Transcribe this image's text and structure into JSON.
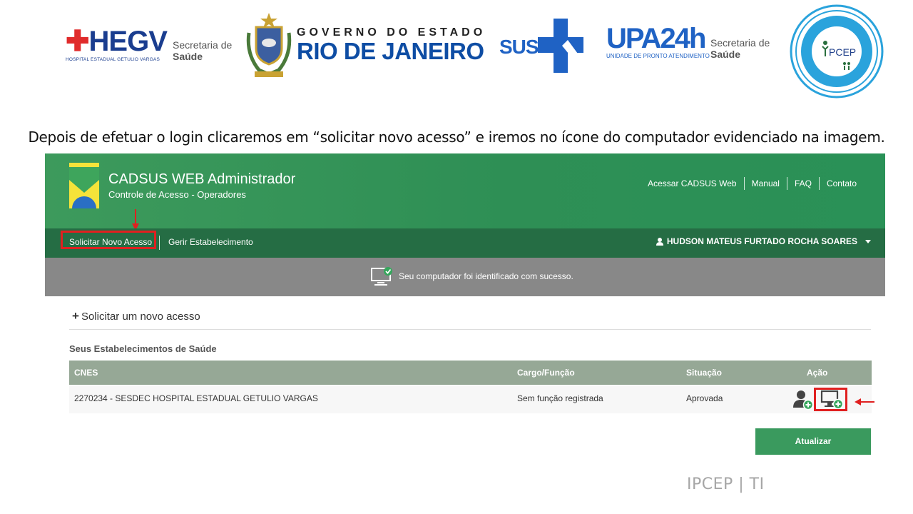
{
  "logos": {
    "hegv": {
      "mark": "HEGV",
      "sub": "HOSPITAL ESTADUAL GETULIO VARGAS"
    },
    "secretaria_1": {
      "line1": "Secretaria de",
      "line2": "Saúde"
    },
    "governo": {
      "line1": "GOVERNO DO ESTADO",
      "line2": "RIO DE JANEIRO"
    },
    "sus": {
      "text": "SUS"
    },
    "upa": {
      "mark_a": "UPA",
      "mark_b": "24h",
      "sub": "UNIDADE DE PRONTO ATENDIMENTO"
    },
    "secretaria_2": {
      "line1": "Secretaria de",
      "line2": "Saúde"
    },
    "ipcep": {
      "text": "PCEP"
    }
  },
  "caption": "Depois de efetuar o login clicaremos em “solicitar novo acesso” e iremos no ícone do computador evidenciado na imagem.",
  "app": {
    "title": "CADSUS WEB Administrador",
    "subtitle": "Controle de Acesso - Operadores",
    "top_links": [
      "Acessar CADSUS Web",
      "Manual",
      "FAQ",
      "Contato"
    ],
    "nav": {
      "item1": "Solicitar Novo Acesso",
      "item2": "Gerir Estabelecimento",
      "user": "HUDSON MATEUS FURTADO ROCHA SOARES"
    },
    "notice": "Seu computador foi identificado com sucesso.",
    "request_link": "Solicitar um novo acesso",
    "section_title": "Seus Estabelecimentos de Saúde",
    "table": {
      "headers": [
        "CNES",
        "Cargo/Função",
        "Situação",
        "Ação"
      ],
      "row": {
        "cnes": "2270234 - SESDEC HOSPITAL ESTADUAL GETULIO VARGAS",
        "cargo": "Sem função registrada",
        "situacao": "Aprovada"
      }
    },
    "update_button": "Atualizar"
  },
  "footer": "IPCEP | TI",
  "colors": {
    "header_green": "#2e8f55",
    "nav_green": "#256d44",
    "notice_gray": "#888888",
    "table_header": "#96a896",
    "highlight_red": "#e02020",
    "button_green": "#3a9a5e"
  }
}
